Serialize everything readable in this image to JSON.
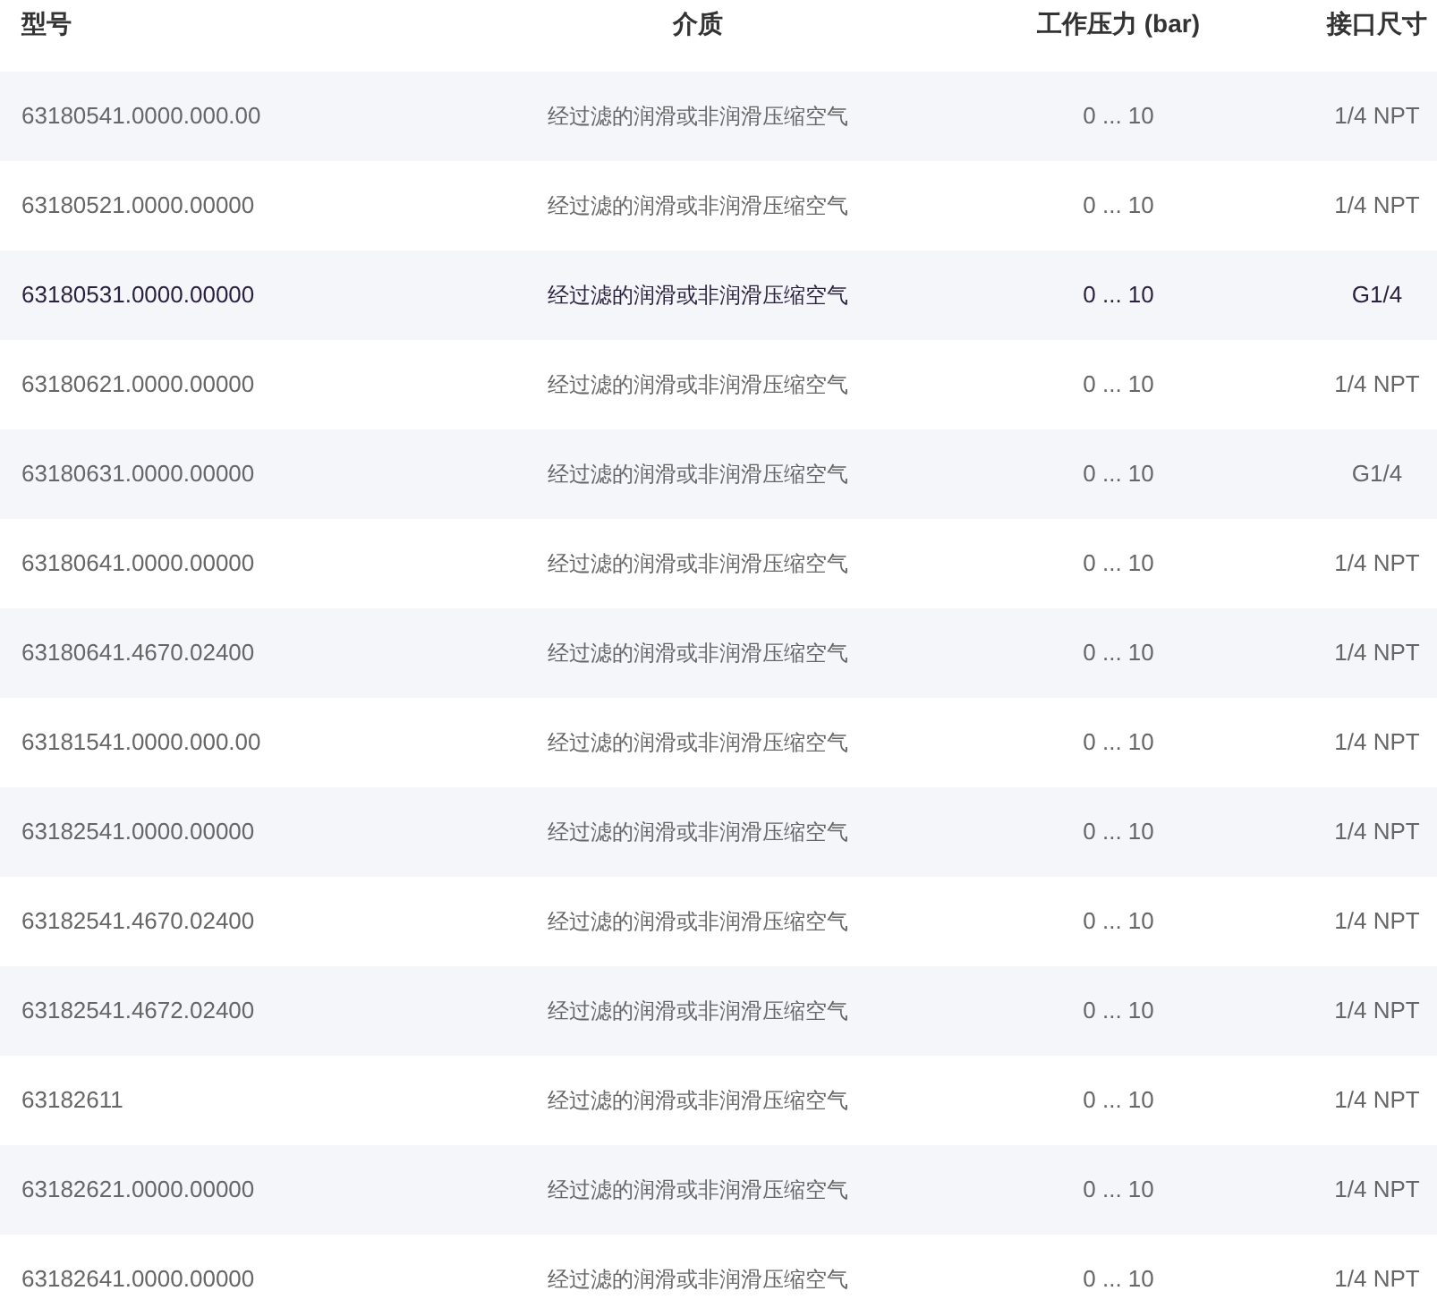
{
  "table": {
    "columns": [
      "型号",
      "介质",
      "工作压力 (bar)",
      "接口尺寸"
    ],
    "rows": [
      {
        "cells": [
          "63180541.0000.000.00",
          "经过滤的润滑或非润滑压缩空气",
          "0 ... 10",
          "1/4 NPT"
        ],
        "highlighted": false
      },
      {
        "cells": [
          "63180521.0000.00000",
          "经过滤的润滑或非润滑压缩空气",
          "0 ... 10",
          "1/4 NPT"
        ],
        "highlighted": false
      },
      {
        "cells": [
          "63180531.0000.00000",
          "经过滤的润滑或非润滑压缩空气",
          "0 ... 10",
          "G1/4"
        ],
        "highlighted": true
      },
      {
        "cells": [
          "63180621.0000.00000",
          "经过滤的润滑或非润滑压缩空气",
          "0 ... 10",
          "1/4 NPT"
        ],
        "highlighted": false
      },
      {
        "cells": [
          "63180631.0000.00000",
          "经过滤的润滑或非润滑压缩空气",
          "0 ... 10",
          "G1/4"
        ],
        "highlighted": false
      },
      {
        "cells": [
          "63180641.0000.00000",
          "经过滤的润滑或非润滑压缩空气",
          "0 ... 10",
          "1/4 NPT"
        ],
        "highlighted": false
      },
      {
        "cells": [
          "63180641.4670.02400",
          "经过滤的润滑或非润滑压缩空气",
          "0 ... 10",
          "1/4 NPT"
        ],
        "highlighted": false
      },
      {
        "cells": [
          "63181541.0000.000.00",
          "经过滤的润滑或非润滑压缩空气",
          "0 ... 10",
          "1/4 NPT"
        ],
        "highlighted": false
      },
      {
        "cells": [
          "63182541.0000.00000",
          "经过滤的润滑或非润滑压缩空气",
          "0 ... 10",
          "1/4 NPT"
        ],
        "highlighted": false
      },
      {
        "cells": [
          "63182541.4670.02400",
          "经过滤的润滑或非润滑压缩空气",
          "0 ... 10",
          "1/4 NPT"
        ],
        "highlighted": false
      },
      {
        "cells": [
          "63182541.4672.02400",
          "经过滤的润滑或非润滑压缩空气",
          "0 ... 10",
          "1/4 NPT"
        ],
        "highlighted": false
      },
      {
        "cells": [
          "63182611",
          "经过滤的润滑或非润滑压缩空气",
          "0 ... 10",
          "1/4 NPT"
        ],
        "highlighted": false
      },
      {
        "cells": [
          "63182621.0000.00000",
          "经过滤的润滑或非润滑压缩空气",
          "0 ... 10",
          "1/4 NPT"
        ],
        "highlighted": false
      },
      {
        "cells": [
          "63182641.0000.00000",
          "经过滤的润滑或非润滑压缩空气",
          "0 ... 10",
          "1/4 NPT"
        ],
        "highlighted": false
      }
    ]
  }
}
